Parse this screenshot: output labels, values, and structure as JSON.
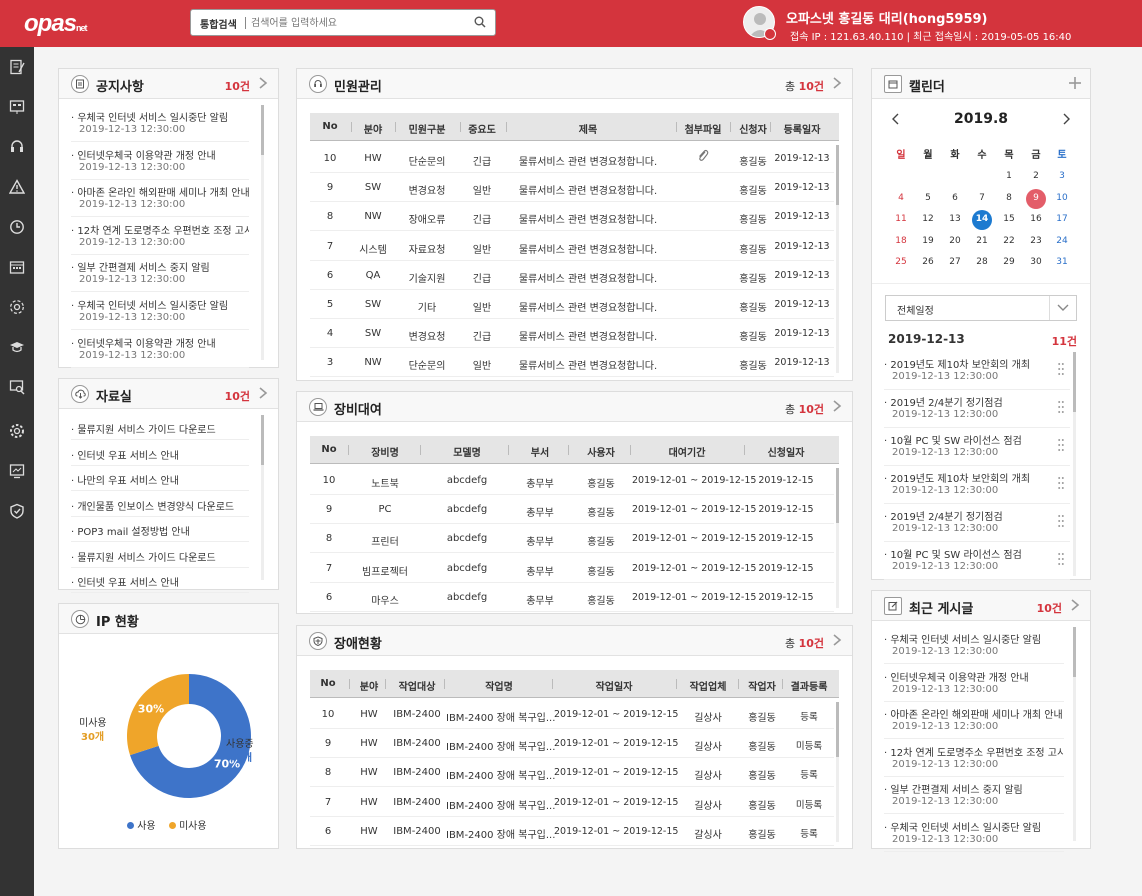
{
  "header": {
    "logo": "opas",
    "logo_sub": "net",
    "search_label": "통합검색",
    "search_placeholder": "검색어를 입력하세요",
    "user_name": "오파스넷 홍길동 대리(hong5959)",
    "user_info": "접속 IP : 121.63.40.110 | 최근 접속일시 : 2019-05-05 16:40"
  },
  "notice": {
    "title": "공지사항",
    "count": "10건",
    "items": [
      {
        "t": "· 우체국 인터넷 서비스 일시중단 알림",
        "d": "2019-12-13 12:30:00"
      },
      {
        "t": "· 인터넷우체국 이용약관 개정 안내",
        "d": "2019-12-13 12:30:00"
      },
      {
        "t": "· 아마존 온라인 해외판매 세미나 개최 안내",
        "d": "2019-12-13 12:30:00"
      },
      {
        "t": "· 12차 연계 도로명주소 우편번호 조정 고시",
        "d": "2019-12-13 12:30:00"
      },
      {
        "t": "· 일부 간편결제 서비스 중지 알림",
        "d": "2019-12-13 12:30:00"
      },
      {
        "t": "· 우체국 인터넷 서비스 일시중단 알림",
        "d": "2019-12-13 12:30:00"
      },
      {
        "t": "· 인터넷우체국 이용약관 개정 안내",
        "d": "2019-12-13 12:30:00"
      }
    ]
  },
  "archive": {
    "title": "자료실",
    "count": "10건",
    "items": [
      "· 물류지원 서비스 가이드 다운로드",
      "· 인터넷 우표 서비스 안내",
      "· 나만의 우표 서비스 안내",
      "· 개인물품 인보이스 변경양식 다운로드",
      "· POP3 mail 설정방법 안내",
      "· 물류지원 서비스 가이드 다운로드",
      "· 인터넷 우표 서비스 안내"
    ]
  },
  "ip": {
    "title": "IP 현황",
    "unused_label": "미사용",
    "unused_count": "30개",
    "used_label": "사용중",
    "used_count": "70개",
    "legend_used": "사용",
    "legend_unused": "미사용",
    "colors": {
      "used": "#3e74c9",
      "unused": "#efa52a"
    }
  },
  "chart_data": {
    "type": "pie",
    "categories": [
      "사용중",
      "미사용"
    ],
    "values": [
      70,
      30
    ],
    "labels": [
      "70%",
      "30%"
    ]
  },
  "complaint": {
    "title": "민원관리",
    "total_prefix": "총",
    "count": "10건",
    "cols": [
      "No",
      "분야",
      "민원구분",
      "중요도",
      "제목",
      "첨부파일",
      "신청자",
      "등록일자"
    ],
    "rows": [
      [
        "10",
        "HW",
        "단순문의",
        "긴급",
        "물류서비스 관련 변경요청합니다.",
        "clip",
        "홍길동",
        "2019-12-13"
      ],
      [
        "9",
        "SW",
        "변경요청",
        "일반",
        "물류서비스 관련 변경요청합니다.",
        "",
        "홍길동",
        "2019-12-13"
      ],
      [
        "8",
        "NW",
        "장애오류",
        "긴급",
        "물류서비스 관련 변경요청합니다.",
        "",
        "홍길동",
        "2019-12-13"
      ],
      [
        "7",
        "시스템",
        "자료요청",
        "일반",
        "물류서비스 관련 변경요청합니다.",
        "",
        "홍길동",
        "2019-12-13"
      ],
      [
        "6",
        "QA",
        "기술지원",
        "긴급",
        "물류서비스 관련 변경요청합니다.",
        "",
        "홍길동",
        "2019-12-13"
      ],
      [
        "5",
        "SW",
        "기타",
        "일반",
        "물류서비스 관련 변경요청합니다.",
        "",
        "홍길동",
        "2019-12-13"
      ],
      [
        "4",
        "SW",
        "변경요청",
        "긴급",
        "물류서비스 관련 변경요청합니다.",
        "",
        "홍길동",
        "2019-12-13"
      ],
      [
        "3",
        "NW",
        "단순문의",
        "일반",
        "물류서비스 관련 변경요청합니다.",
        "",
        "홍길동",
        "2019-12-13"
      ]
    ]
  },
  "rental": {
    "title": "장비대여",
    "total_prefix": "총",
    "count": "10건",
    "cols": [
      "No",
      "장비명",
      "모델명",
      "부서",
      "사용자",
      "대여기간",
      "신청일자"
    ],
    "rows": [
      [
        "10",
        "노트북",
        "abcdefg",
        "총무부",
        "홍길동",
        "2019-12-01 ~ 2019-12-15",
        "2019-12-15"
      ],
      [
        "9",
        "PC",
        "abcdefg",
        "총무부",
        "홍길동",
        "2019-12-01 ~ 2019-12-15",
        "2019-12-15"
      ],
      [
        "8",
        "프린터",
        "abcdefg",
        "총무부",
        "홍길동",
        "2019-12-01 ~ 2019-12-15",
        "2019-12-15"
      ],
      [
        "7",
        "빔프로젝터",
        "abcdefg",
        "총무부",
        "홍길동",
        "2019-12-01 ~ 2019-12-15",
        "2019-12-15"
      ],
      [
        "6",
        "마우스",
        "abcdefg",
        "총무부",
        "홍길동",
        "2019-12-01 ~ 2019-12-15",
        "2019-12-15"
      ]
    ]
  },
  "fault": {
    "title": "장애현황",
    "total_prefix": "총",
    "count": "10건",
    "cols": [
      "No",
      "분야",
      "작업대상",
      "작업명",
      "작업일자",
      "작업업체",
      "작업자",
      "결과등록"
    ],
    "rows": [
      [
        "10",
        "HW",
        "IBM-2400",
        "IBM-2400 장애 복구입...",
        "2019-12-01 ~ 2019-12-15",
        "길상사",
        "홍길동",
        "등록"
      ],
      [
        "9",
        "HW",
        "IBM-2400",
        "IBM-2400 장애 복구입...",
        "2019-12-01 ~ 2019-12-15",
        "길상사",
        "홍길동",
        "미등록"
      ],
      [
        "8",
        "HW",
        "IBM-2400",
        "IBM-2400 장애 복구입...",
        "2019-12-01 ~ 2019-12-15",
        "길상사",
        "홍길동",
        "등록"
      ],
      [
        "7",
        "HW",
        "IBM-2400",
        "IBM-2400 장애 복구입...",
        "2019-12-01 ~ 2019-12-15",
        "길상사",
        "홍길동",
        "미등록"
      ],
      [
        "6",
        "HW",
        "IBM-2400",
        "IBM-2400 장애 복구입...",
        "2019-12-01 ~ 2019-12-15",
        "갈싱사",
        "홍길동",
        "등록"
      ]
    ]
  },
  "calendar": {
    "title": "캘린더",
    "year_month": "2019.8",
    "weekdays": [
      "일",
      "월",
      "화",
      "수",
      "목",
      "금",
      "토"
    ],
    "weeks": [
      [
        "",
        "",
        "",
        "",
        "1",
        "2",
        "3"
      ],
      [
        "4",
        "5",
        "6",
        "7",
        "8",
        "9",
        "10"
      ],
      [
        "11",
        "12",
        "13",
        "14",
        "15",
        "16",
        "17"
      ],
      [
        "18",
        "19",
        "20",
        "21",
        "22",
        "23",
        "24"
      ],
      [
        "25",
        "26",
        "27",
        "28",
        "29",
        "30",
        "31"
      ]
    ],
    "highlight_red": "9",
    "highlight_blue": "14",
    "filter": "전체일정",
    "selected_date": "2019-12-13",
    "event_count": "11건",
    "events": [
      {
        "t": "· 2019년도 제10차 보안회의 개최",
        "d": "2019-12-13 12:30:00"
      },
      {
        "t": "· 2019년 2/4분기 정기점검",
        "d": "2019-12-13 12:30:00"
      },
      {
        "t": "· 10월 PC 및 SW 라이선스 점검",
        "d": "2019-12-13 12:30:00"
      },
      {
        "t": "· 2019년도 제10차 보안회의 개최",
        "d": "2019-12-13 12:30:00"
      },
      {
        "t": "· 2019년 2/4분기 정기점검",
        "d": "2019-12-13 12:30:00"
      },
      {
        "t": "· 10월 PC 및 SW 라이선스 점검",
        "d": "2019-12-13 12:30:00"
      }
    ]
  },
  "recent": {
    "title": "최근 게시글",
    "count": "10건",
    "items": [
      {
        "t": "· 우체국 인터넷 서비스 일시중단 알림",
        "d": "2019-12-13 12:30:00"
      },
      {
        "t": "· 인터넷우체국 이용약관 개정 안내",
        "d": "2019-12-13 12:30:00"
      },
      {
        "t": "· 아마존 온라인 해외판매 세미나 개최 안내",
        "d": "2019-12-13 12:30:00"
      },
      {
        "t": "· 12차 연계 도로명주소 우편번호 조정 고시",
        "d": "2019-12-13 12:30:00"
      },
      {
        "t": "· 일부 간편결제 서비스 중지 알림",
        "d": "2019-12-13 12:30:00"
      },
      {
        "t": "· 우체국 인터넷 서비스 일시중단 알림",
        "d": "2019-12-13 12:30:00"
      }
    ]
  },
  "sidebar_icons": [
    "document-icon",
    "dashboard-icon",
    "headset-icon",
    "warning-icon",
    "clock-icon",
    "calendar-icon",
    "network-icon",
    "graduation-icon",
    "search-doc-icon",
    "gear-icon",
    "monitor-icon",
    "shield-icon"
  ]
}
